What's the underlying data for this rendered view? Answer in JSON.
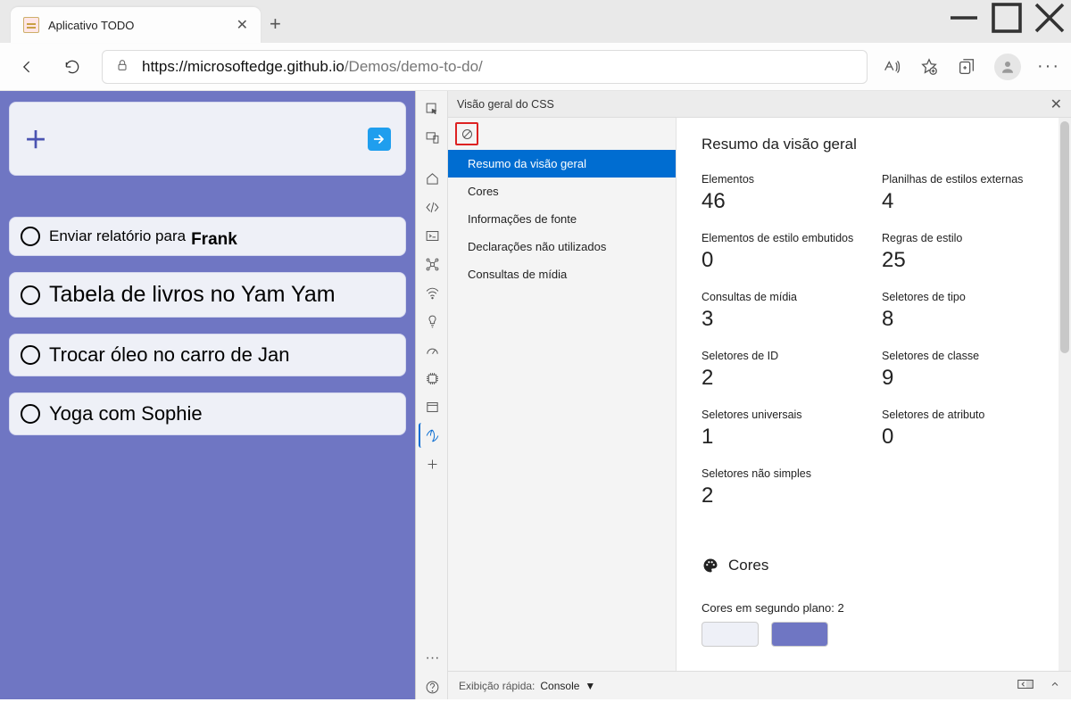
{
  "window": {
    "tab_title": "Aplicativo TODO"
  },
  "address": {
    "protocol": "https://",
    "host": "microsoftedge.github.io",
    "path": "/Demos/demo-to-do/"
  },
  "page": {
    "todos": [
      "Enviar relatório para",
      "Tabela de livros no Yam Yam",
      "Trocar óleo no carro de Jan",
      "Yoga com Sophie"
    ],
    "todo0_suffix": "Frank"
  },
  "devtools": {
    "panel_title": "Visão geral do CSS",
    "tree": {
      "summary": "Resumo da visão geral",
      "colors": "Cores",
      "font": "Informações de fonte",
      "unused": "Declarações não utilizados",
      "media": "Consultas de mídia"
    },
    "content": {
      "title": "Resumo da visão geral",
      "stats": [
        {
          "label": "Elementos",
          "value": "46"
        },
        {
          "label": "Planilhas de estilos externas",
          "value": "4"
        },
        {
          "label": "Elementos de estilo embutidos",
          "value": "0"
        },
        {
          "label": "Regras de estilo",
          "value": "25"
        },
        {
          "label": "Consultas de mídia",
          "value": "3"
        },
        {
          "label": "Seletores de tipo",
          "value": "8"
        },
        {
          "label": "Seletores de ID",
          "value": "2"
        },
        {
          "label": "Seletores de classe",
          "value": "9"
        },
        {
          "label": "Seletores universais",
          "value": "1"
        },
        {
          "label": "Seletores de atributo",
          "value": "0"
        },
        {
          "label": "Seletores não simples",
          "value": "2"
        }
      ],
      "colors_heading": "Cores",
      "bg_colors_label": "Cores em segundo plano: 2",
      "swatches": [
        "#eef0f7",
        "#6f76c3"
      ]
    },
    "drawer": {
      "label": "Exibição rápida:",
      "tab": "Console"
    }
  }
}
